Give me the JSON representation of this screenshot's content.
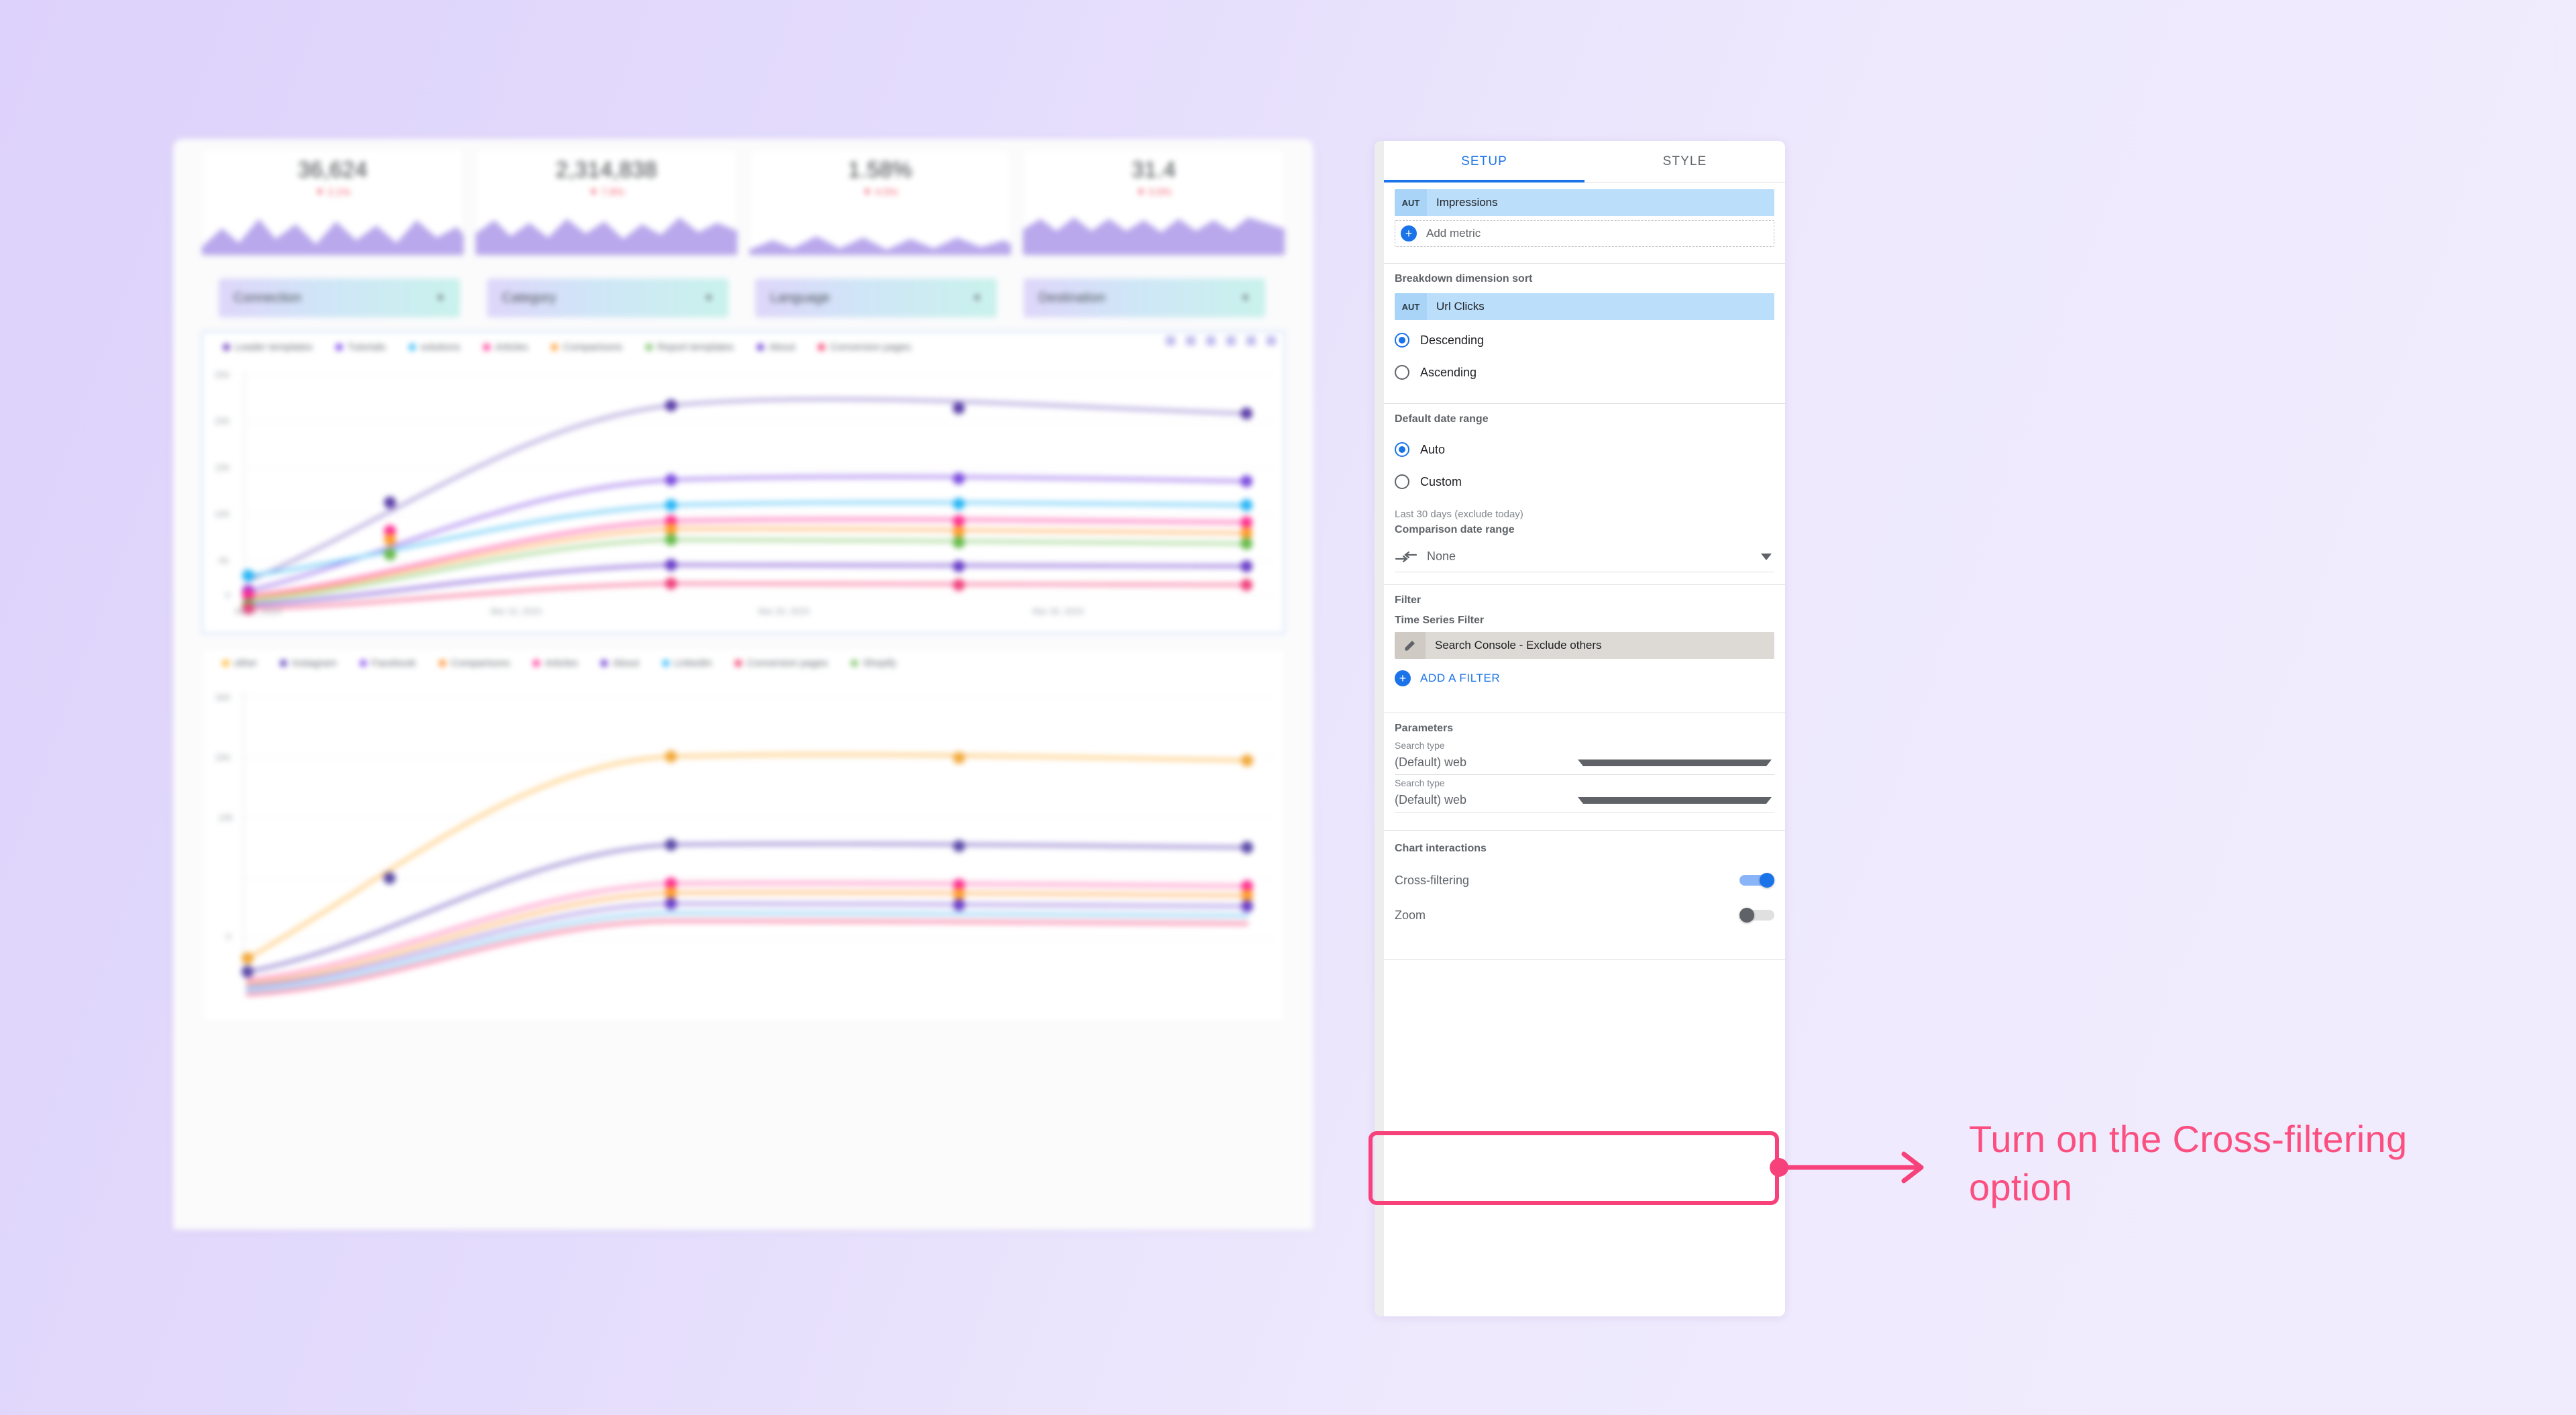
{
  "theme": {
    "accent_blue": "#1a73e8",
    "highlight_pink": "#f7417a",
    "callout_pink": "#fb4f80",
    "bg_gradient_from": "#ddd2fb",
    "bg_gradient_to": "#f1ecfd"
  },
  "report": {
    "scorecards": [
      {
        "value": "36,624",
        "delta": "▼ 2.1%"
      },
      {
        "value": "2,314,838",
        "delta": "▼ 7.8%"
      },
      {
        "value": "1.58%",
        "delta": "▼ 4.5%"
      },
      {
        "value": "31.4",
        "delta": "▼ 0.9%"
      }
    ],
    "filter_chips": [
      {
        "label": "Connection",
        "caret": "▼"
      },
      {
        "label": "Category",
        "caret": "▼"
      },
      {
        "label": "Language",
        "caret": "▼"
      },
      {
        "label": "Destination",
        "caret": "▼"
      }
    ],
    "chart_toolbar_icons": [
      "share-icon",
      "edit-icon",
      "more-icon",
      "filter-icon",
      "table-icon",
      "download-icon"
    ],
    "chart1": {
      "legend": [
        {
          "label": "Leader templates",
          "color": "#7e57c2"
        },
        {
          "label": "Tutorials",
          "color": "#8e5cf0"
        },
        {
          "label": "solutions",
          "color": "#4fc3f7"
        },
        {
          "label": "Articles",
          "color": "#ff4fa3"
        },
        {
          "label": "Comparisons",
          "color": "#ffa94d"
        },
        {
          "label": "Report templates",
          "color": "#8bc97a"
        },
        {
          "label": "About",
          "color": "#7c52d6"
        },
        {
          "label": "Conversion pages",
          "color": "#f5527c"
        }
      ]
    },
    "chart2": {
      "legend": [
        {
          "label": "other",
          "color": "#ffc14d"
        },
        {
          "label": "Instagram",
          "color": "#7257c4"
        },
        {
          "label": "Facebook",
          "color": "#9a6bf2"
        },
        {
          "label": "Comparisons",
          "color": "#ff9d47"
        },
        {
          "label": "Articles",
          "color": "#ff4fa3"
        },
        {
          "label": "About",
          "color": "#7c52d6"
        },
        {
          "label": "LinkedIn",
          "color": "#4fc3f7"
        },
        {
          "label": "Conversion pages",
          "color": "#f5527c"
        },
        {
          "label": "Shopify",
          "color": "#8bc97a"
        }
      ]
    }
  },
  "panel": {
    "tabs": [
      {
        "label": "SETUP",
        "active": true
      },
      {
        "label": "STYLE",
        "active": false
      }
    ],
    "metric": {
      "badge": "AUT",
      "name": "Impressions",
      "add_label": "Add metric",
      "add_icon": "plus-icon"
    },
    "breakdown_sort": {
      "title": "Breakdown dimension sort",
      "field_badge": "AUT",
      "field_name": "Url Clicks",
      "options": [
        {
          "label": "Descending",
          "selected": true
        },
        {
          "label": "Ascending",
          "selected": false
        }
      ]
    },
    "date_range": {
      "title": "Default date range",
      "options": [
        {
          "label": "Auto",
          "selected": true
        },
        {
          "label": "Custom",
          "selected": false
        }
      ],
      "note": "Last 30 days (exclude today)",
      "comparison_label": "Comparison date range",
      "comparison_value": "None",
      "comparison_icon": "compare-arrows-icon"
    },
    "filter": {
      "title": "Filter",
      "sub_label": "Time Series Filter",
      "chip_name": "Search Console - Exclude others",
      "chip_icon": "pencil-icon",
      "add_label": "ADD A FILTER",
      "add_icon": "plus-icon"
    },
    "parameters": {
      "title": "Parameters",
      "rows": [
        {
          "label": "Search type",
          "value": "(Default) web"
        },
        {
          "label": "Search type",
          "value": "(Default) web"
        }
      ]
    },
    "chart_interactions": {
      "title": "Chart interactions",
      "toggles": [
        {
          "label": "Cross-filtering",
          "on": true
        },
        {
          "label": "Zoom",
          "on": false
        }
      ]
    }
  },
  "callout": {
    "text": "Turn on the Cross-filtering option",
    "arrow_icon": "arrow-right-icon",
    "anchor_icon": "anchor-dot-icon"
  }
}
